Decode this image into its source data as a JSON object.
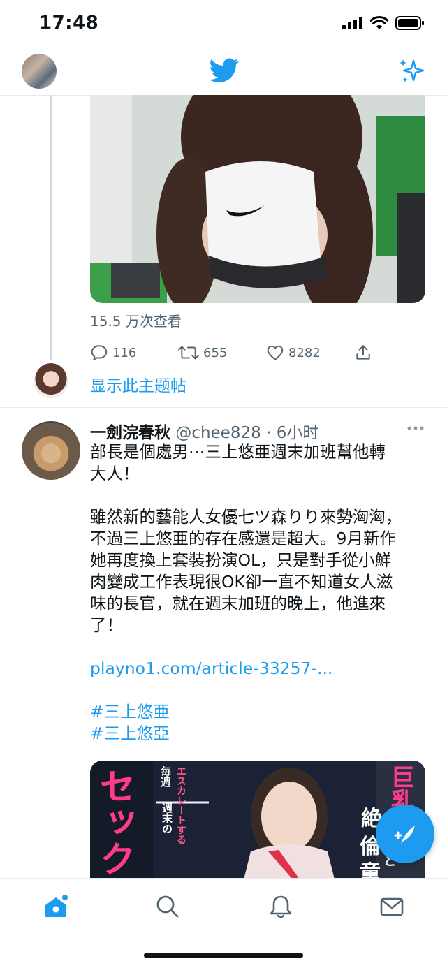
{
  "status_bar": {
    "time": "17:48"
  },
  "header": {
    "logo": "twitter-bird-icon",
    "right_icon": "sparkle-icon",
    "profile_avatar": "profile-avatar"
  },
  "thread_tweet": {
    "views": "15.5 万次查看",
    "actions": {
      "replies": "116",
      "retweets": "655",
      "likes": "8282"
    },
    "show_thread": "显示此主题帖"
  },
  "tweet": {
    "display_name": "一劍浣春秋",
    "handle": "@chee828",
    "separator": "·",
    "time": "6小时",
    "more_icon": "more-horizontal-icon",
    "lines": [
      "部長是個處男⋯三上悠亜週末加班幫他轉",
      "大人！",
      "",
      "雖然新的藝能人女優七ツ森りり來勢洶洶，",
      "不過三上悠亜的存在感還是超大。9月新作",
      "她再度換上套裝扮演OL，只是對手從小鮮",
      "肉變成工作表現很OK卻一直不知道女人滋",
      "味的長官，就在週末加班的晚上，他進來",
      "了！"
    ],
    "link": "playno1.com/article-33257-...",
    "hashtags": [
      "#三上悠亜",
      "#三上悠亞"
    ],
    "image_text": {
      "a": "毎週",
      "b": "エスカレートする",
      "c": "週末の",
      "d": "セック",
      "e": "巨乳",
      "f": "絶",
      "g": "倫",
      "h": "童",
      "i": "と"
    }
  },
  "colors": {
    "accent": "#1d9bf0",
    "text": "#0f1419",
    "muted": "#536471",
    "border": "#e6ecf0"
  },
  "tabbar": {
    "items": [
      "home-icon",
      "search-icon",
      "notifications-icon",
      "messages-icon"
    ]
  }
}
